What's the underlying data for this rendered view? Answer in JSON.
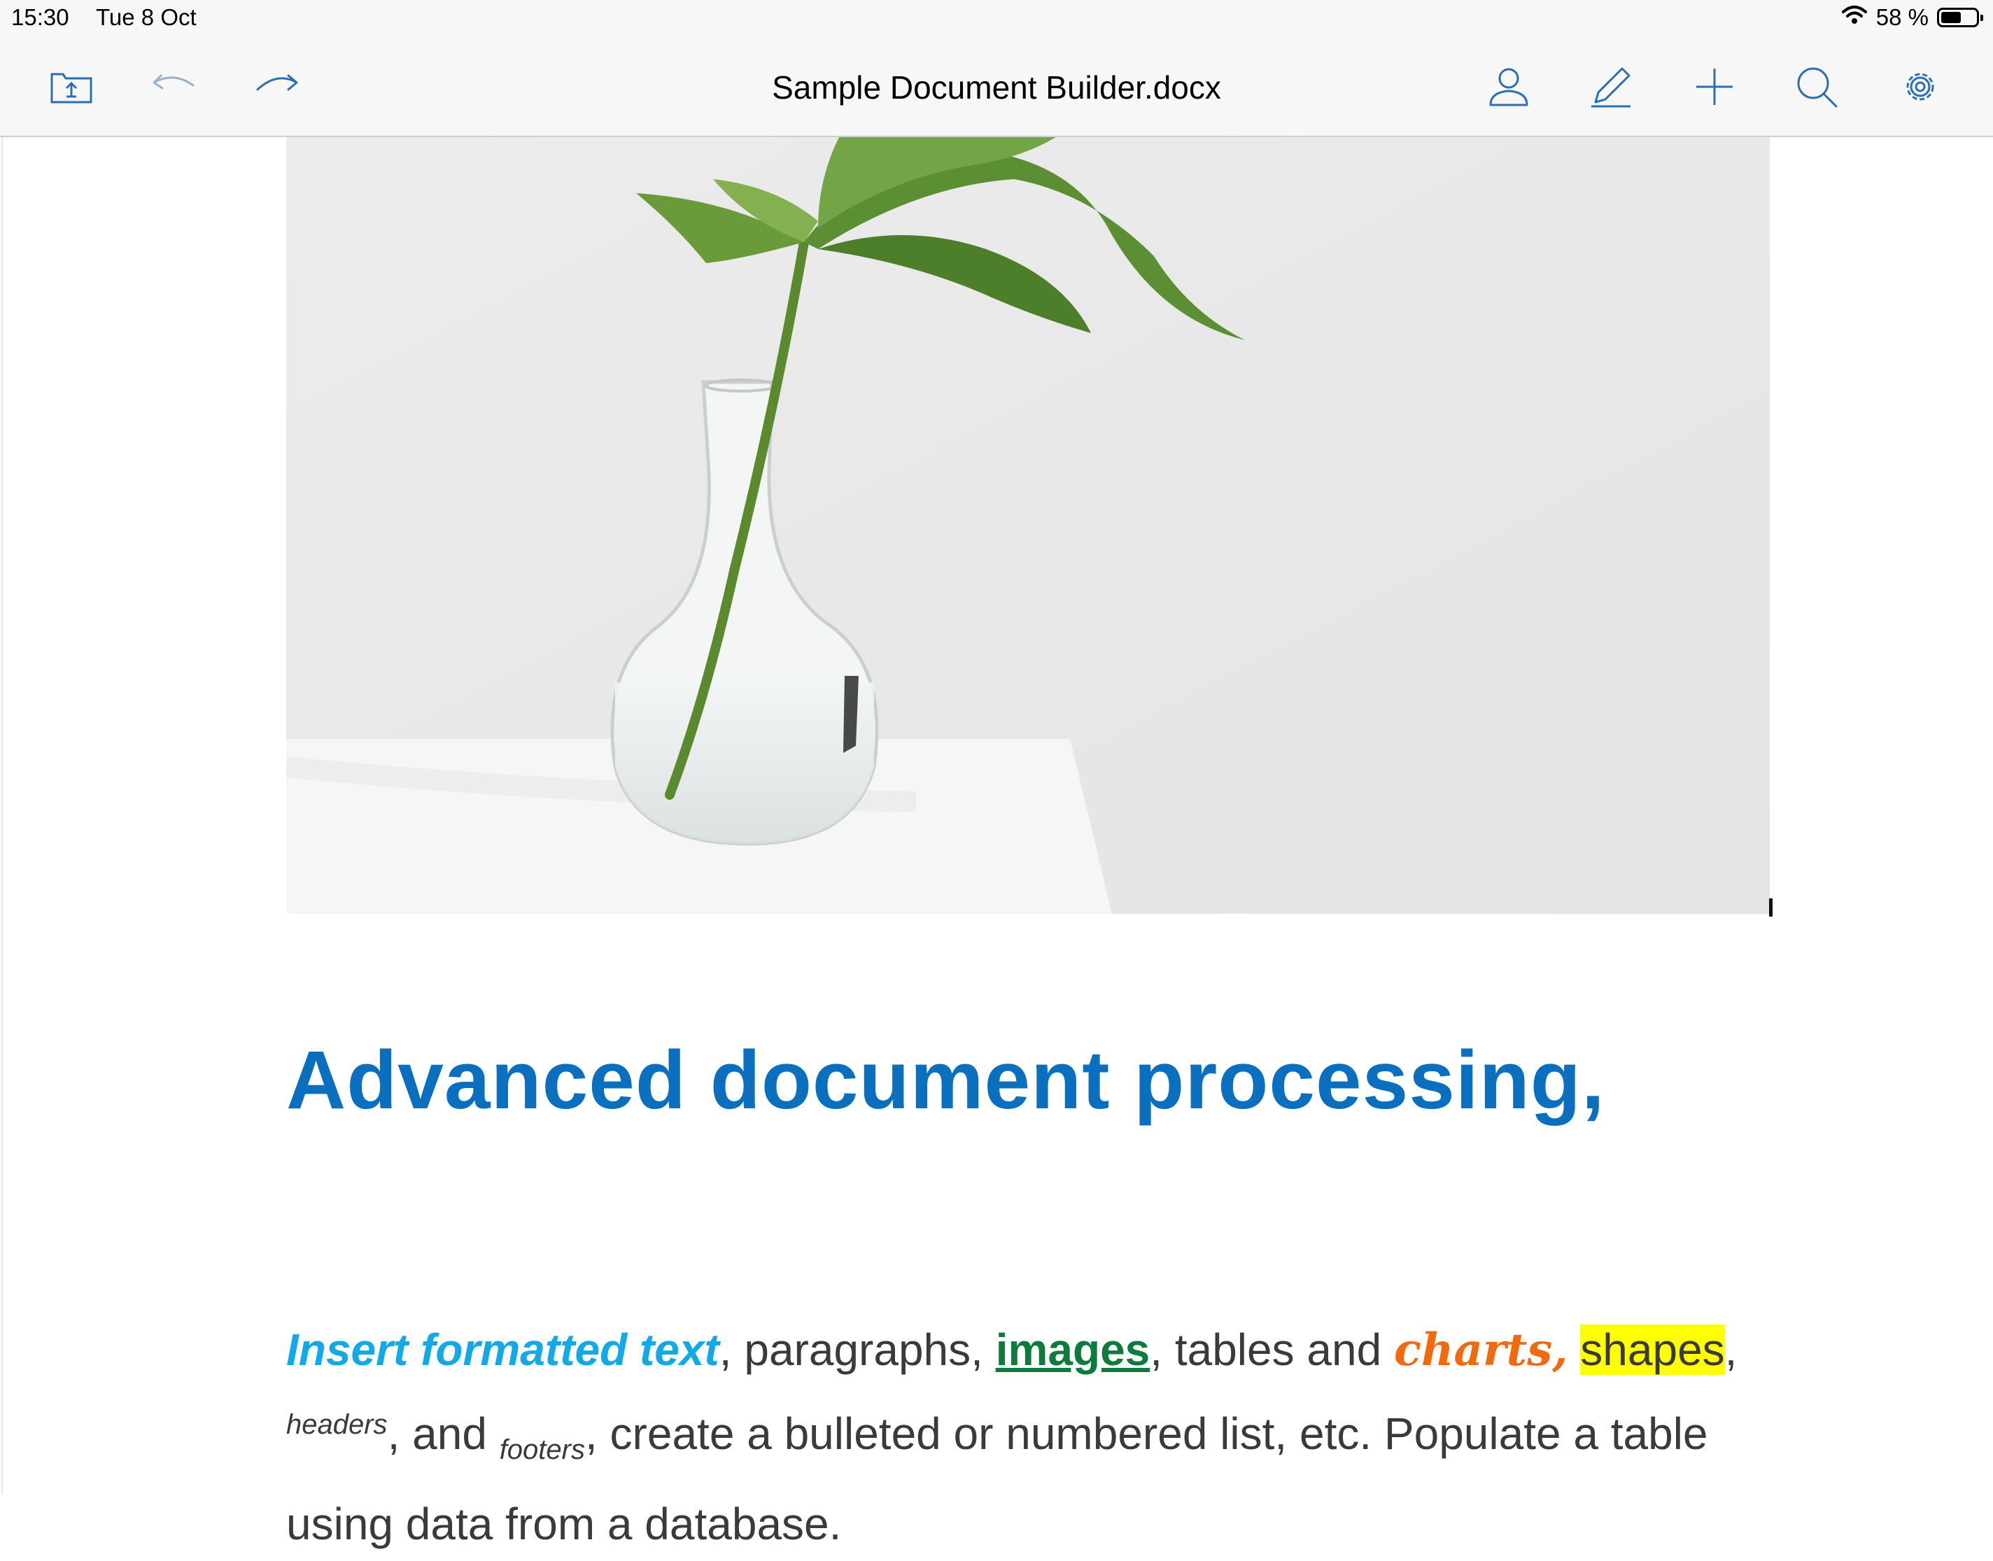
{
  "status": {
    "time": "15:30",
    "date": "Tue 8 Oct",
    "battery_text": "58 %",
    "battery_level": 0.58
  },
  "toolbar": {
    "title": "Sample Document Builder.docx",
    "left_icons": [
      "folder-upload-icon",
      "undo-icon",
      "redo-icon"
    ],
    "right_icons": [
      "person-icon",
      "pencil-icon",
      "plus-icon",
      "search-icon",
      "gear-icon"
    ]
  },
  "document": {
    "heading": "Advanced document processing,",
    "paragraph": {
      "insert": "Insert formatted text",
      "sep1": ", ",
      "paragraphs": "paragraphs, ",
      "images": "images",
      "tables": ", tables and ",
      "charts": "charts,",
      "shapes": "shapes",
      "comma": ",",
      "headers": "headers",
      "and": ", and ",
      "footers": "footers",
      "rest_line2": ", create a bulleted or numbered list, etc. Populate a table",
      "line3": "using data from a database."
    },
    "colors": {
      "heading": "#0a6fbf",
      "insert": "#13a8e8",
      "images": "#0e7a3b",
      "charts": "#f26a0f",
      "highlight": "#ffff00"
    }
  }
}
